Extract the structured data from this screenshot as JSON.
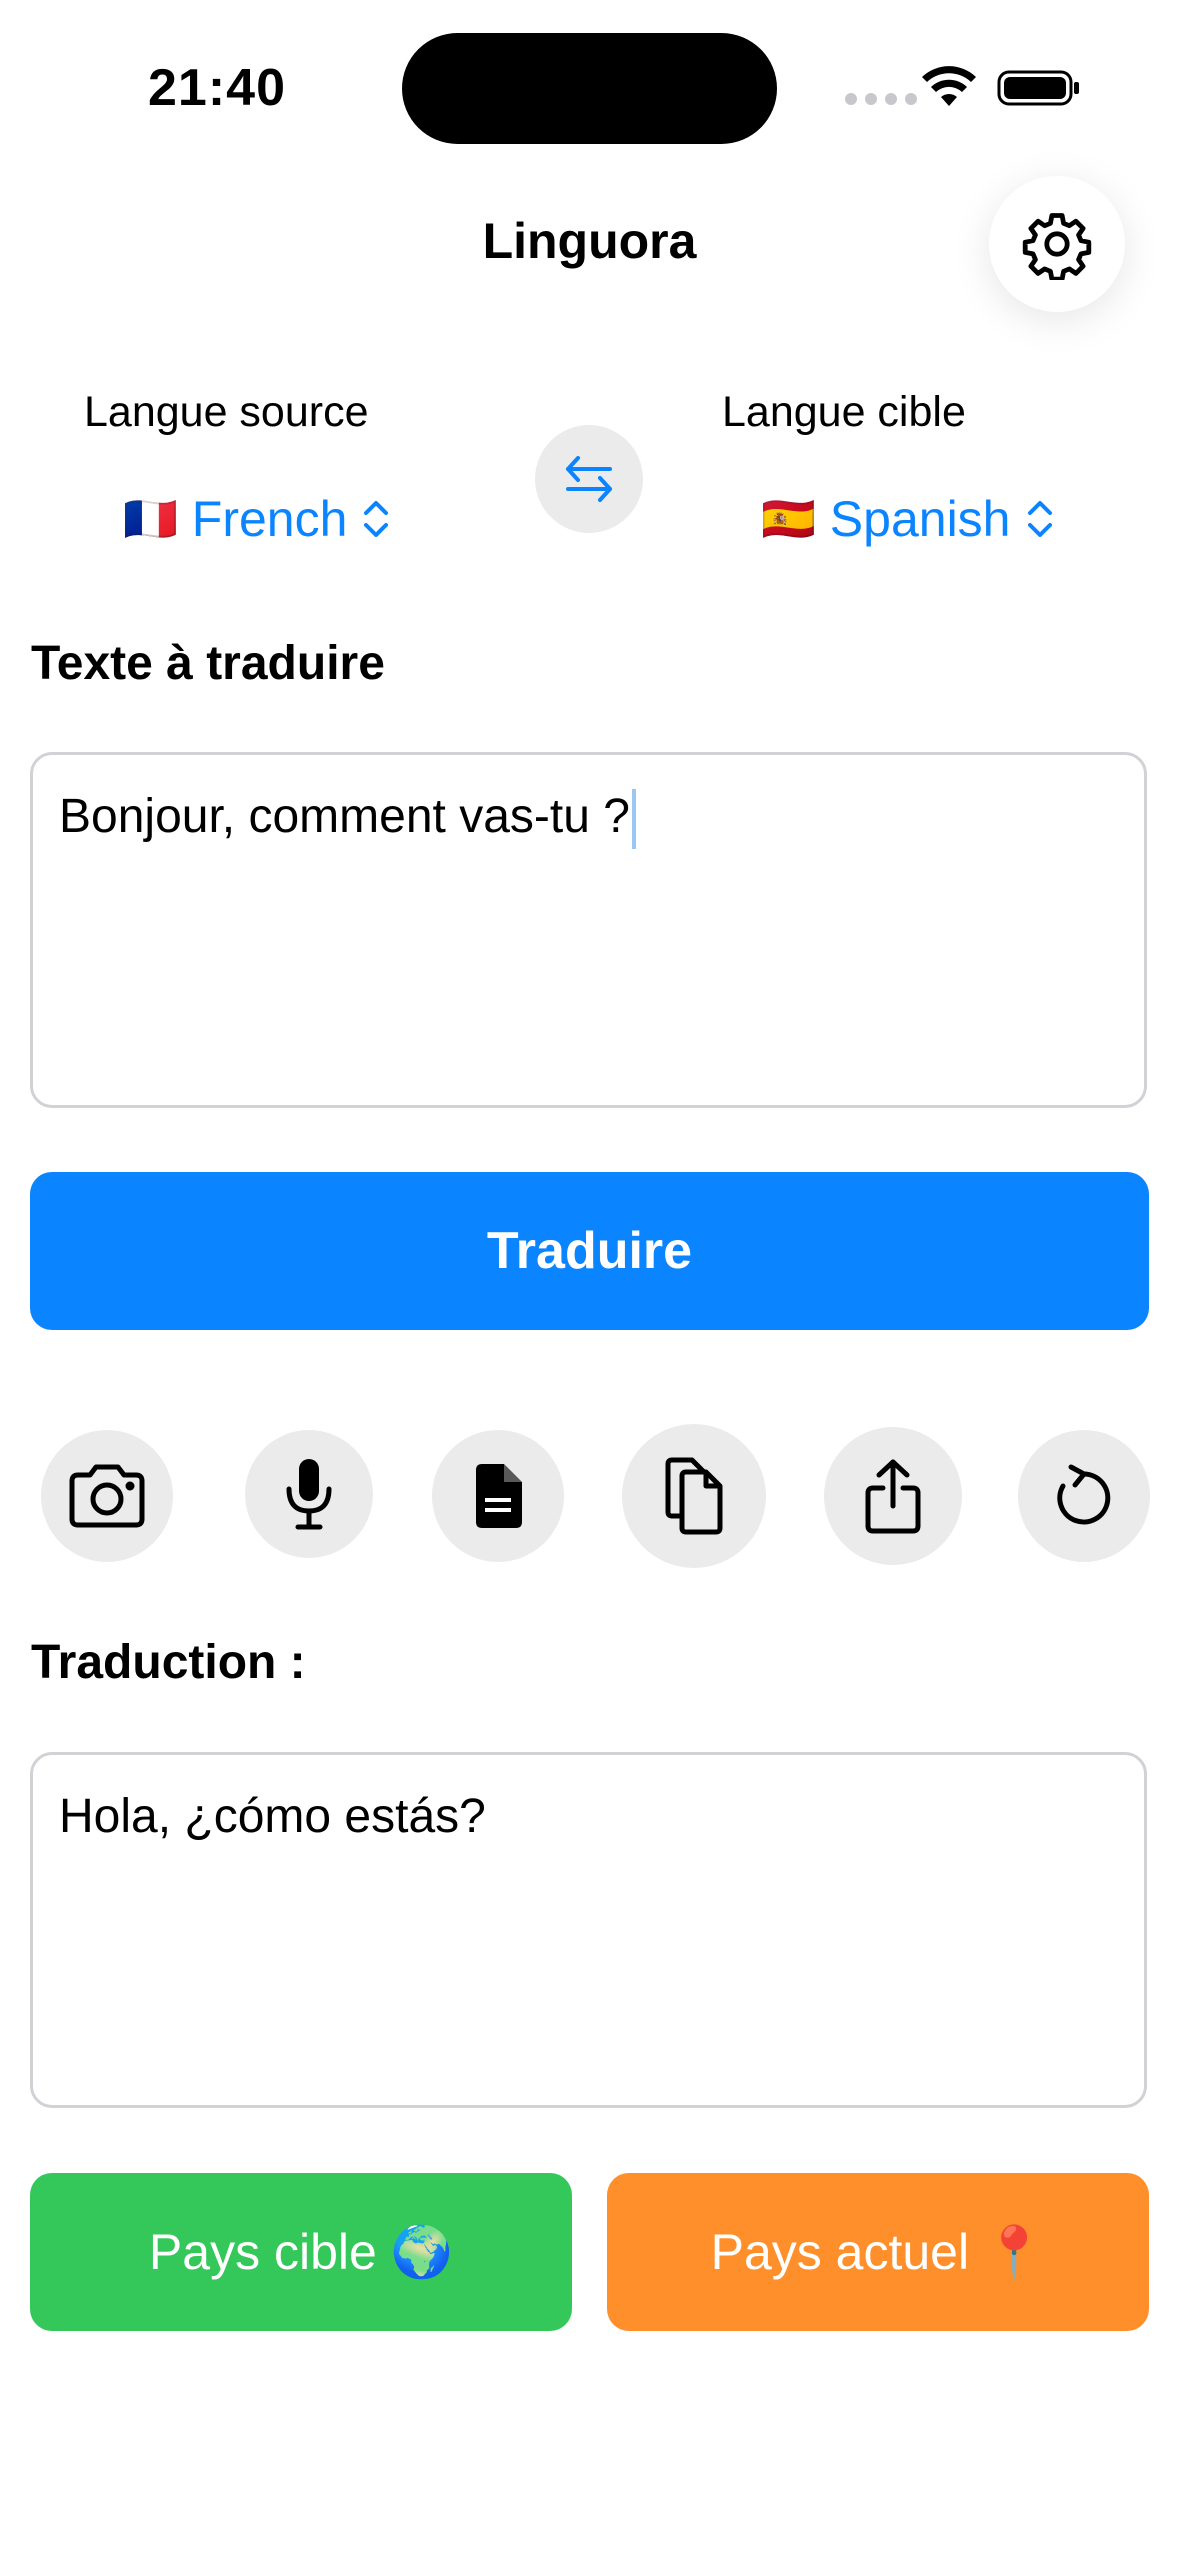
{
  "status_bar": {
    "time": "21:40"
  },
  "header": {
    "title": "Linguora",
    "settings_icon": "gear-icon"
  },
  "languages": {
    "source_label": "Langue source",
    "source_flag": "🇫🇷",
    "source_value": "French",
    "target_label": "Langue cible",
    "target_flag": "🇪🇸",
    "target_value": "Spanish",
    "swap_icon": "swap-arrows-icon"
  },
  "input": {
    "title": "Texte à traduire",
    "value": "Bonjour, comment vas-tu ?"
  },
  "translate_button": {
    "label": "Traduire"
  },
  "tools": [
    {
      "name": "camera",
      "icon": "camera-icon"
    },
    {
      "name": "microphone",
      "icon": "microphone-icon"
    },
    {
      "name": "document",
      "icon": "document-icon"
    },
    {
      "name": "copy",
      "icon": "copy-icon"
    },
    {
      "name": "share",
      "icon": "share-icon"
    },
    {
      "name": "reset",
      "icon": "reset-icon"
    }
  ],
  "output": {
    "title": "Traduction :",
    "value": "Hola, ¿cómo estás?"
  },
  "bottom_buttons": {
    "target_country_label": "Pays cible",
    "target_country_emoji": "🌍",
    "current_country_label": "Pays actuel",
    "current_country_emoji": "📍"
  },
  "colors": {
    "accent": "#0a84ff",
    "green": "#34c759",
    "orange": "#ff8f2b"
  }
}
